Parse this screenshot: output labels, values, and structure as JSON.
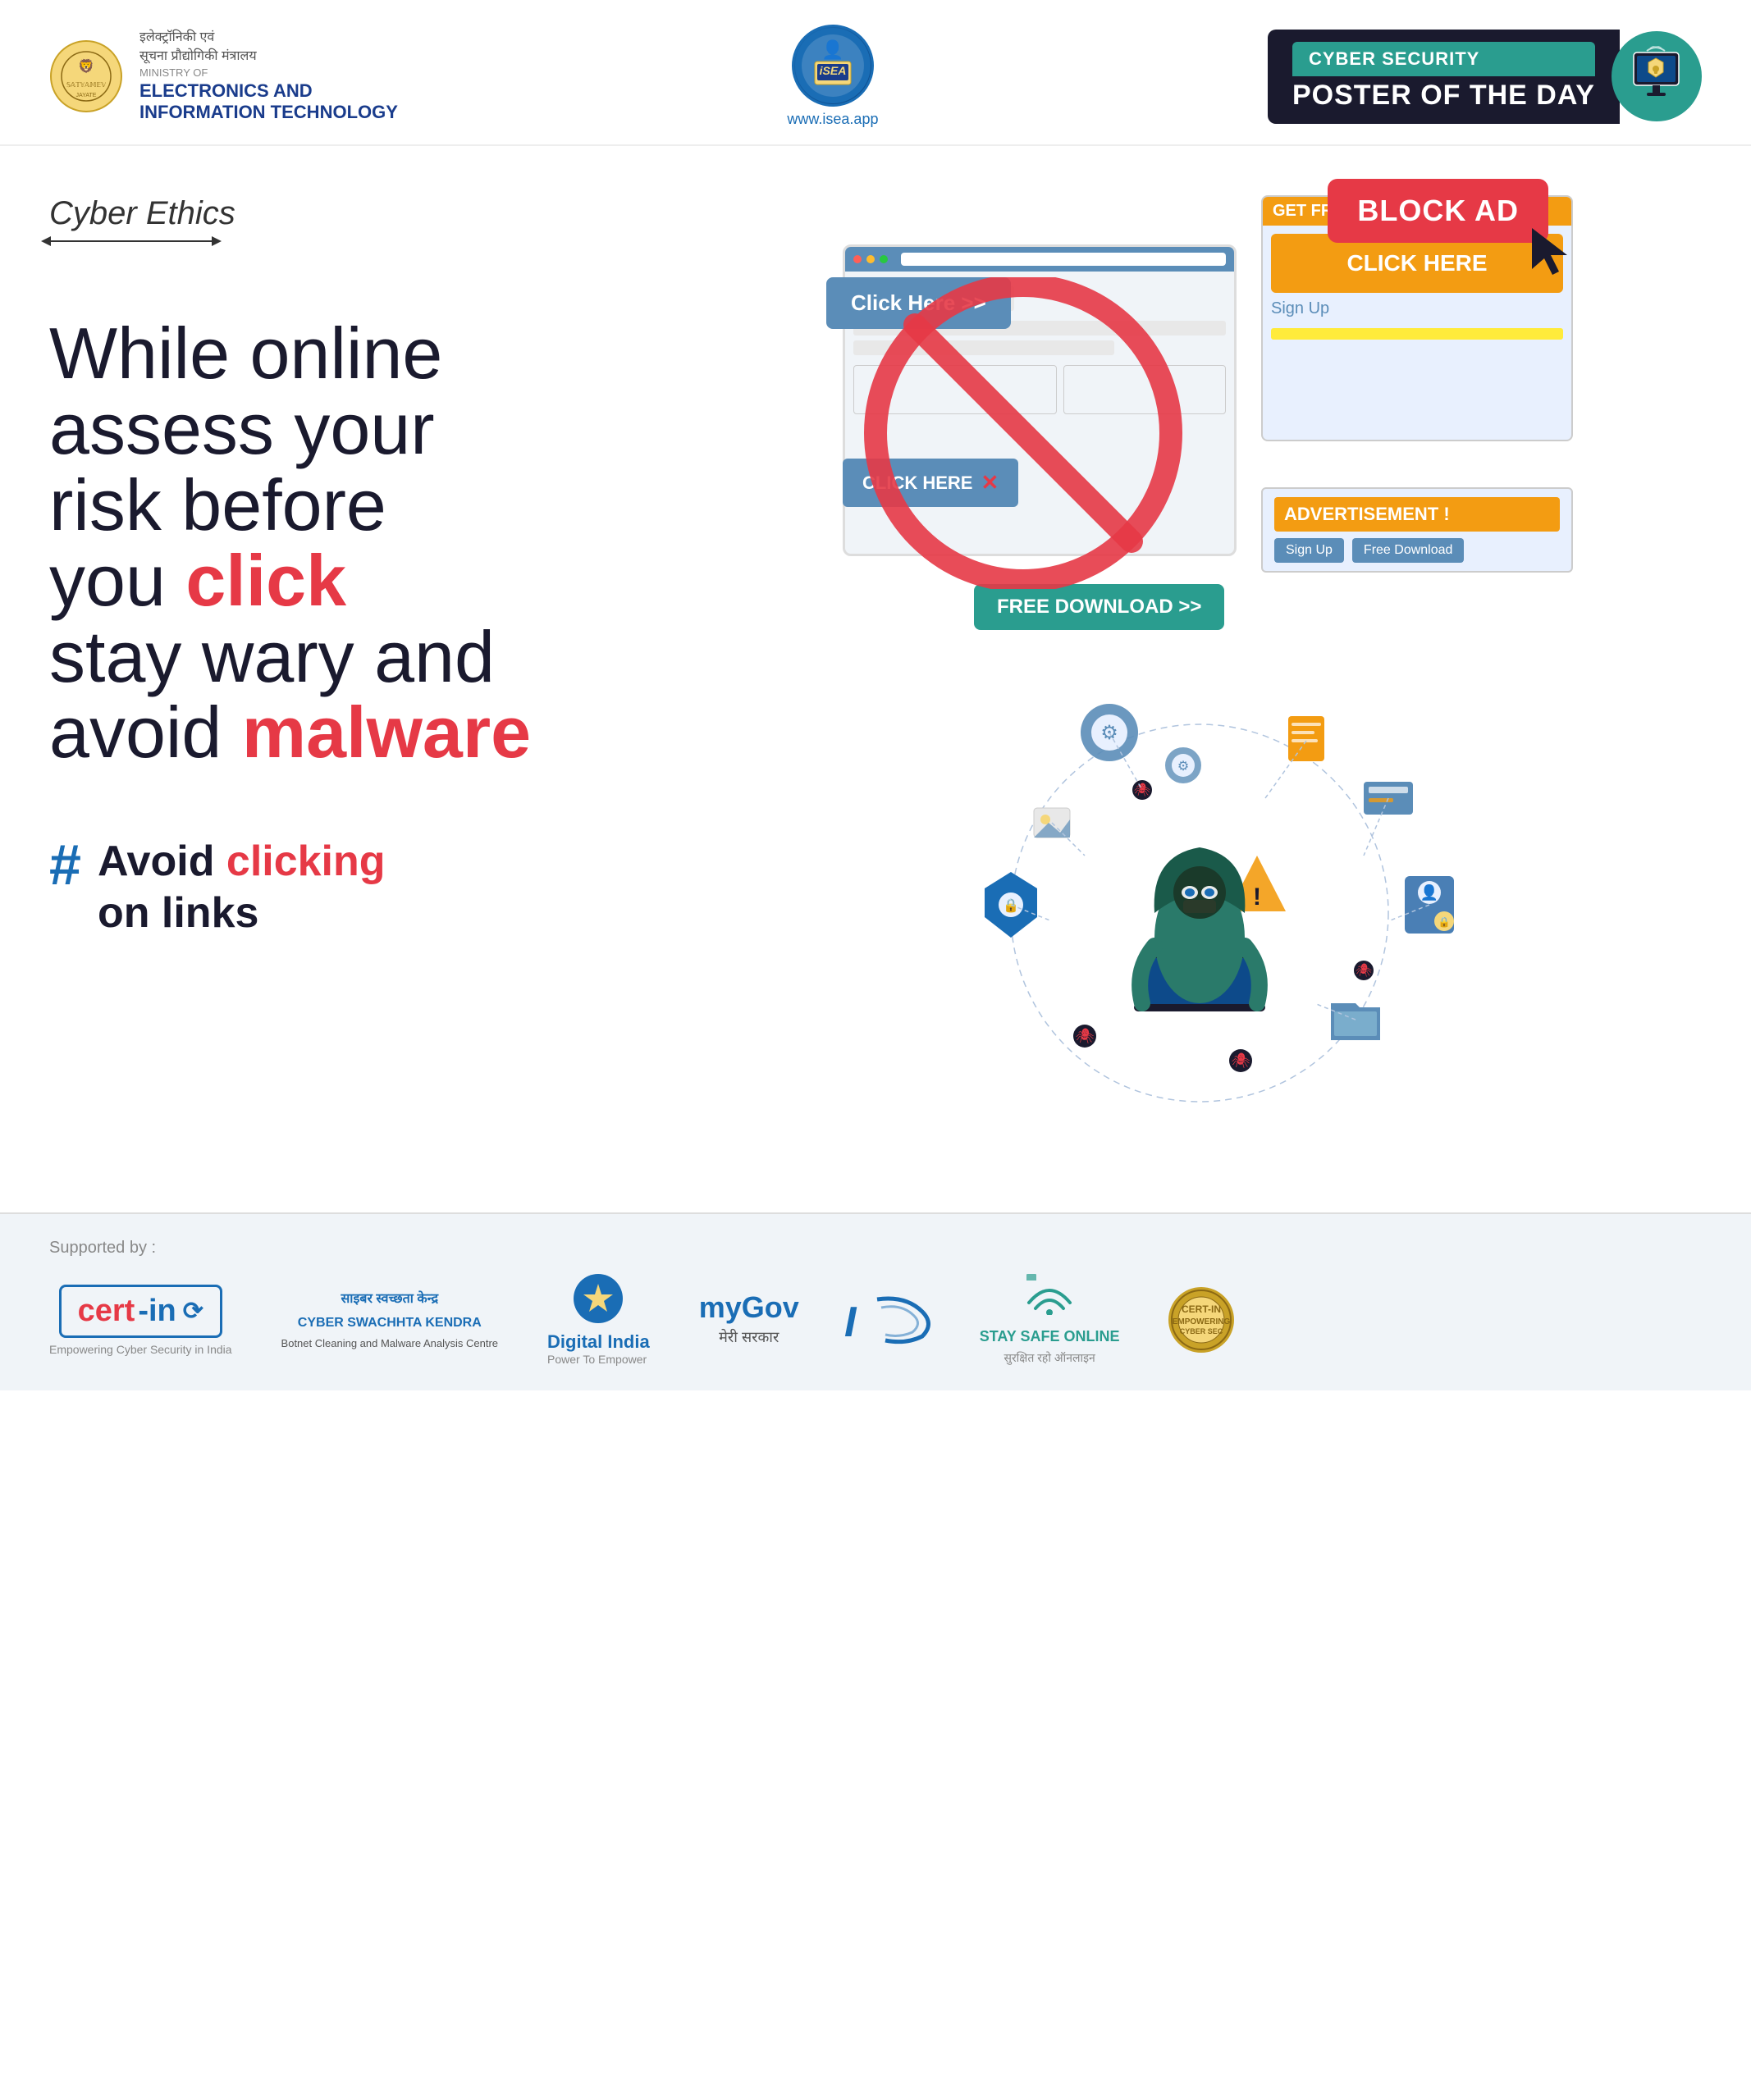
{
  "header": {
    "ministry_hindi_line1": "इलेक्ट्रॉनिकी एवं",
    "ministry_hindi_line2": "सूचना प्रौद्योगिकी मंत्रालय",
    "ministry_label": "MINISTRY OF",
    "ministry_name_line1": "ELECTRONICS AND",
    "ministry_name_line2": "INFORMATION TECHNOLOGY",
    "satyamev_jayate": "सत्यमेव जयते",
    "isea_url": "www.isea.app",
    "cyber_security_label": "CYBER SECURITY",
    "poster_of_day": "POSTER OF THE DAY"
  },
  "main": {
    "category_label": "Cyber Ethics",
    "main_text_line1": "While online",
    "main_text_line2": "assess your",
    "main_text_line3": "risk before",
    "main_text_line4_prefix": "you ",
    "main_text_click": "click",
    "main_text_line5_prefix": "stay wary and",
    "main_text_line6_prefix": "avoid ",
    "main_text_malware": "malware",
    "hashtag_symbol": "#",
    "hashtag_line1_prefix": "Avoid ",
    "hashtag_clicking": "clicking",
    "hashtag_line2": "on links"
  },
  "ad_illustration": {
    "click_here_btn": "Click Here >>",
    "get_free_money": "GET FREE MONEY !",
    "click_here_big": "CLICK HERE",
    "sign_up": "Sign Up",
    "block_ad": "BLOCK AD",
    "click_here_x": "CLICK HERE",
    "advertisement": "ADVERTISEMENT !",
    "sign_up2": "Sign Up",
    "free_download": "Free Download",
    "free_download_banner": "FREE DOWNLOAD >>"
  },
  "hacker_illustration": {
    "aria_label": "Hacker with malware network illustration"
  },
  "footer": {
    "supported_by": "Supported by :",
    "certin_name": "cert-in",
    "certin_sub": "Empowering Cyber Security in India",
    "csk_title": "साइबर स्वच्छता केन्द्र",
    "csk_sub_en": "CYBER SWACHHTA KENDRA",
    "csk_desc": "Botnet Cleaning and Malware Analysis Centre",
    "digital_india_name": "Digital India",
    "digital_india_sub": "Power To Empower",
    "mygov_name": "myGov",
    "mygov_sub": "मेरी सरकार",
    "ic_text": "IC",
    "stay_safe_title": "STAY SAFE ONLINE",
    "stay_safe_sub": "सुरक्षित रहो ऑनलाइन"
  },
  "colors": {
    "primary_blue": "#1a6db5",
    "teal": "#2a9d8f",
    "red": "#e63946",
    "dark": "#1a1a2e",
    "orange": "#f39c12",
    "light_bg": "#f0f4f8"
  }
}
